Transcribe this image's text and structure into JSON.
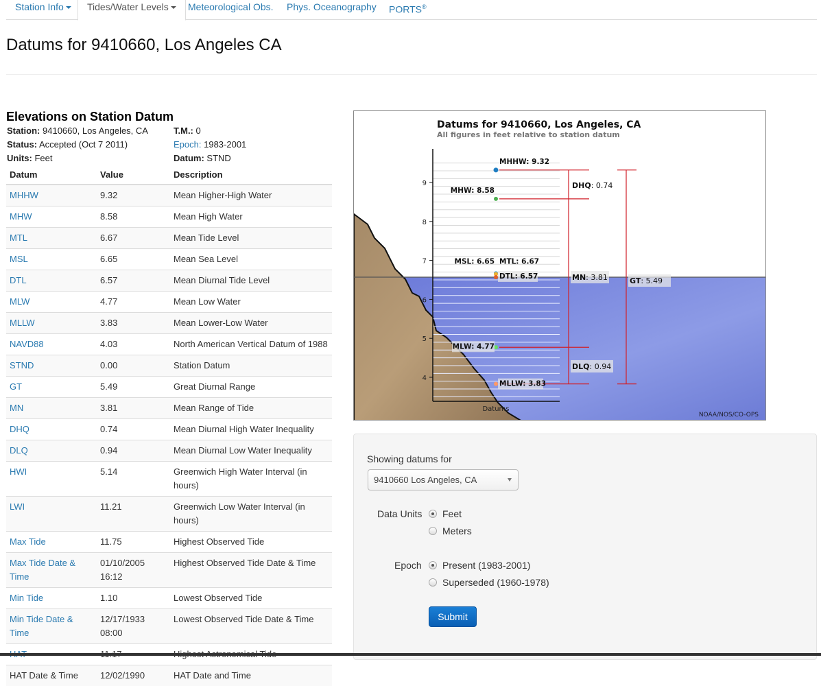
{
  "nav": {
    "tabs": [
      {
        "label": "Station Info",
        "dropdown": true,
        "active": false
      },
      {
        "label": "Tides/Water Levels",
        "dropdown": true,
        "active": true
      },
      {
        "label": "Meteorological Obs.",
        "dropdown": false,
        "active": false
      },
      {
        "label": "Phys. Oceanography",
        "dropdown": false,
        "active": false
      },
      {
        "label": "PORTS",
        "sup": "®",
        "dropdown": false,
        "active": false
      }
    ]
  },
  "page_title": "Datums for 9410660, Los Angeles CA",
  "elevations": {
    "title": "Elevations on Station Datum",
    "station_label": "Station:",
    "station_value": "9410660, Los Angeles, CA",
    "status_label": "Status:",
    "status_value": "Accepted (Oct 7 2011)",
    "units_label": "Units:",
    "units_value": "Feet",
    "tm_label": "T.M.:",
    "tm_value": "0",
    "epoch_label": "Epoch:",
    "epoch_value": "1983-2001",
    "datum_label": "Datum:",
    "datum_value": "STND"
  },
  "table": {
    "headers": [
      "Datum",
      "Value",
      "Description"
    ],
    "rows": [
      {
        "datum": "MHHW",
        "value": "9.32",
        "description": "Mean Higher-High Water",
        "link": true
      },
      {
        "datum": "MHW",
        "value": "8.58",
        "description": "Mean High Water",
        "link": true
      },
      {
        "datum": "MTL",
        "value": "6.67",
        "description": "Mean Tide Level",
        "link": true
      },
      {
        "datum": "MSL",
        "value": "6.65",
        "description": "Mean Sea Level",
        "link": true
      },
      {
        "datum": "DTL",
        "value": "6.57",
        "description": "Mean Diurnal Tide Level",
        "link": true
      },
      {
        "datum": "MLW",
        "value": "4.77",
        "description": "Mean Low Water",
        "link": true
      },
      {
        "datum": "MLLW",
        "value": "3.83",
        "description": "Mean Lower-Low Water",
        "link": true
      },
      {
        "datum": "NAVD88",
        "value": "4.03",
        "description": "North American Vertical Datum of 1988",
        "link": true
      },
      {
        "datum": "STND",
        "value": "0.00",
        "description": "Station Datum",
        "link": true
      },
      {
        "datum": "GT",
        "value": "5.49",
        "description": "Great Diurnal Range",
        "link": true
      },
      {
        "datum": "MN",
        "value": "3.81",
        "description": "Mean Range of Tide",
        "link": true
      },
      {
        "datum": "DHQ",
        "value": "0.74",
        "description": "Mean Diurnal High Water Inequality",
        "link": true
      },
      {
        "datum": "DLQ",
        "value": "0.94",
        "description": "Mean Diurnal Low Water Inequality",
        "link": true
      },
      {
        "datum": "HWI",
        "value": "5.14",
        "description": "Greenwich High Water Interval (in hours)",
        "link": true
      },
      {
        "datum": "LWI",
        "value": "11.21",
        "description": "Greenwich Low Water Interval (in hours)",
        "link": true
      },
      {
        "datum": "Max Tide",
        "value": "11.75",
        "description": "Highest Observed Tide",
        "link": true
      },
      {
        "datum": "Max Tide Date & Time",
        "value": "01/10/2005 16:12",
        "description": "Highest Observed Tide Date & Time",
        "link": true
      },
      {
        "datum": "Min Tide",
        "value": "1.10",
        "description": "Lowest Observed Tide",
        "link": true
      },
      {
        "datum": "Min Tide Date & Time",
        "value": "12/17/1933 08:00",
        "description": "Lowest Observed Tide Date & Time",
        "link": true
      },
      {
        "datum": "HAT",
        "value": "11.17",
        "description": "Highest Astronomical Tide",
        "link": true
      },
      {
        "datum": "HAT Date & Time",
        "value": "12/02/1990",
        "description": "HAT Date and Time",
        "link": false
      }
    ]
  },
  "chart_data": {
    "type": "scatter",
    "title": "Datums for 9410660, Los Angeles, CA",
    "subtitle": "All figures in feet relative to station datum",
    "xlabel": "Datums",
    "ylabel": "",
    "ylim": [
      3.4,
      9.7
    ],
    "yticks": [
      4,
      5,
      6,
      7,
      8,
      9
    ],
    "credit": "NOAA/NOS/CO-OPS",
    "water_level": 6.57,
    "points": [
      {
        "name": "MHHW",
        "value": 9.32,
        "label": "MHHW: 9.32",
        "color": "#1f7ec2"
      },
      {
        "name": "MHW",
        "value": 8.58,
        "label": "MHW: 8.58",
        "color": "#4caf50"
      },
      {
        "name": "MTL",
        "value": 6.67,
        "label": "MTL: 6.67",
        "color": "#3aa0d8"
      },
      {
        "name": "MSL",
        "value": 6.65,
        "label": "MSL: 6.65",
        "color": "#f0b030"
      },
      {
        "name": "DTL",
        "value": 6.57,
        "label": "DTL: 6.57",
        "color": "#e0602a"
      },
      {
        "name": "MLW",
        "value": 4.77,
        "label": "MLW: 4.77",
        "color": "#66dd66"
      },
      {
        "name": "MLLW",
        "value": 3.83,
        "label": "MLLW: 3.83",
        "color": "#ff9966"
      }
    ],
    "ranges": [
      {
        "name": "DHQ",
        "value": 0.74,
        "from": 8.58,
        "to": 9.32
      },
      {
        "name": "MN",
        "value": 3.81,
        "from": 4.77,
        "to": 8.58
      },
      {
        "name": "DLQ",
        "value": 0.94,
        "from": 3.83,
        "to": 4.77
      },
      {
        "name": "GT",
        "value": 5.49,
        "from": 3.83,
        "to": 9.32
      }
    ]
  },
  "form": {
    "showing_label": "Showing datums for",
    "station_select": "9410660 Los Angeles, CA",
    "units_label": "Data Units",
    "units_options": [
      {
        "label": "Feet",
        "checked": true
      },
      {
        "label": "Meters",
        "checked": false
      }
    ],
    "epoch_label": "Epoch",
    "epoch_options": [
      {
        "label": "Present (1983-2001)",
        "checked": true
      },
      {
        "label": "Superseded (1960-1978)",
        "checked": false
      }
    ],
    "submit_label": "Submit"
  }
}
